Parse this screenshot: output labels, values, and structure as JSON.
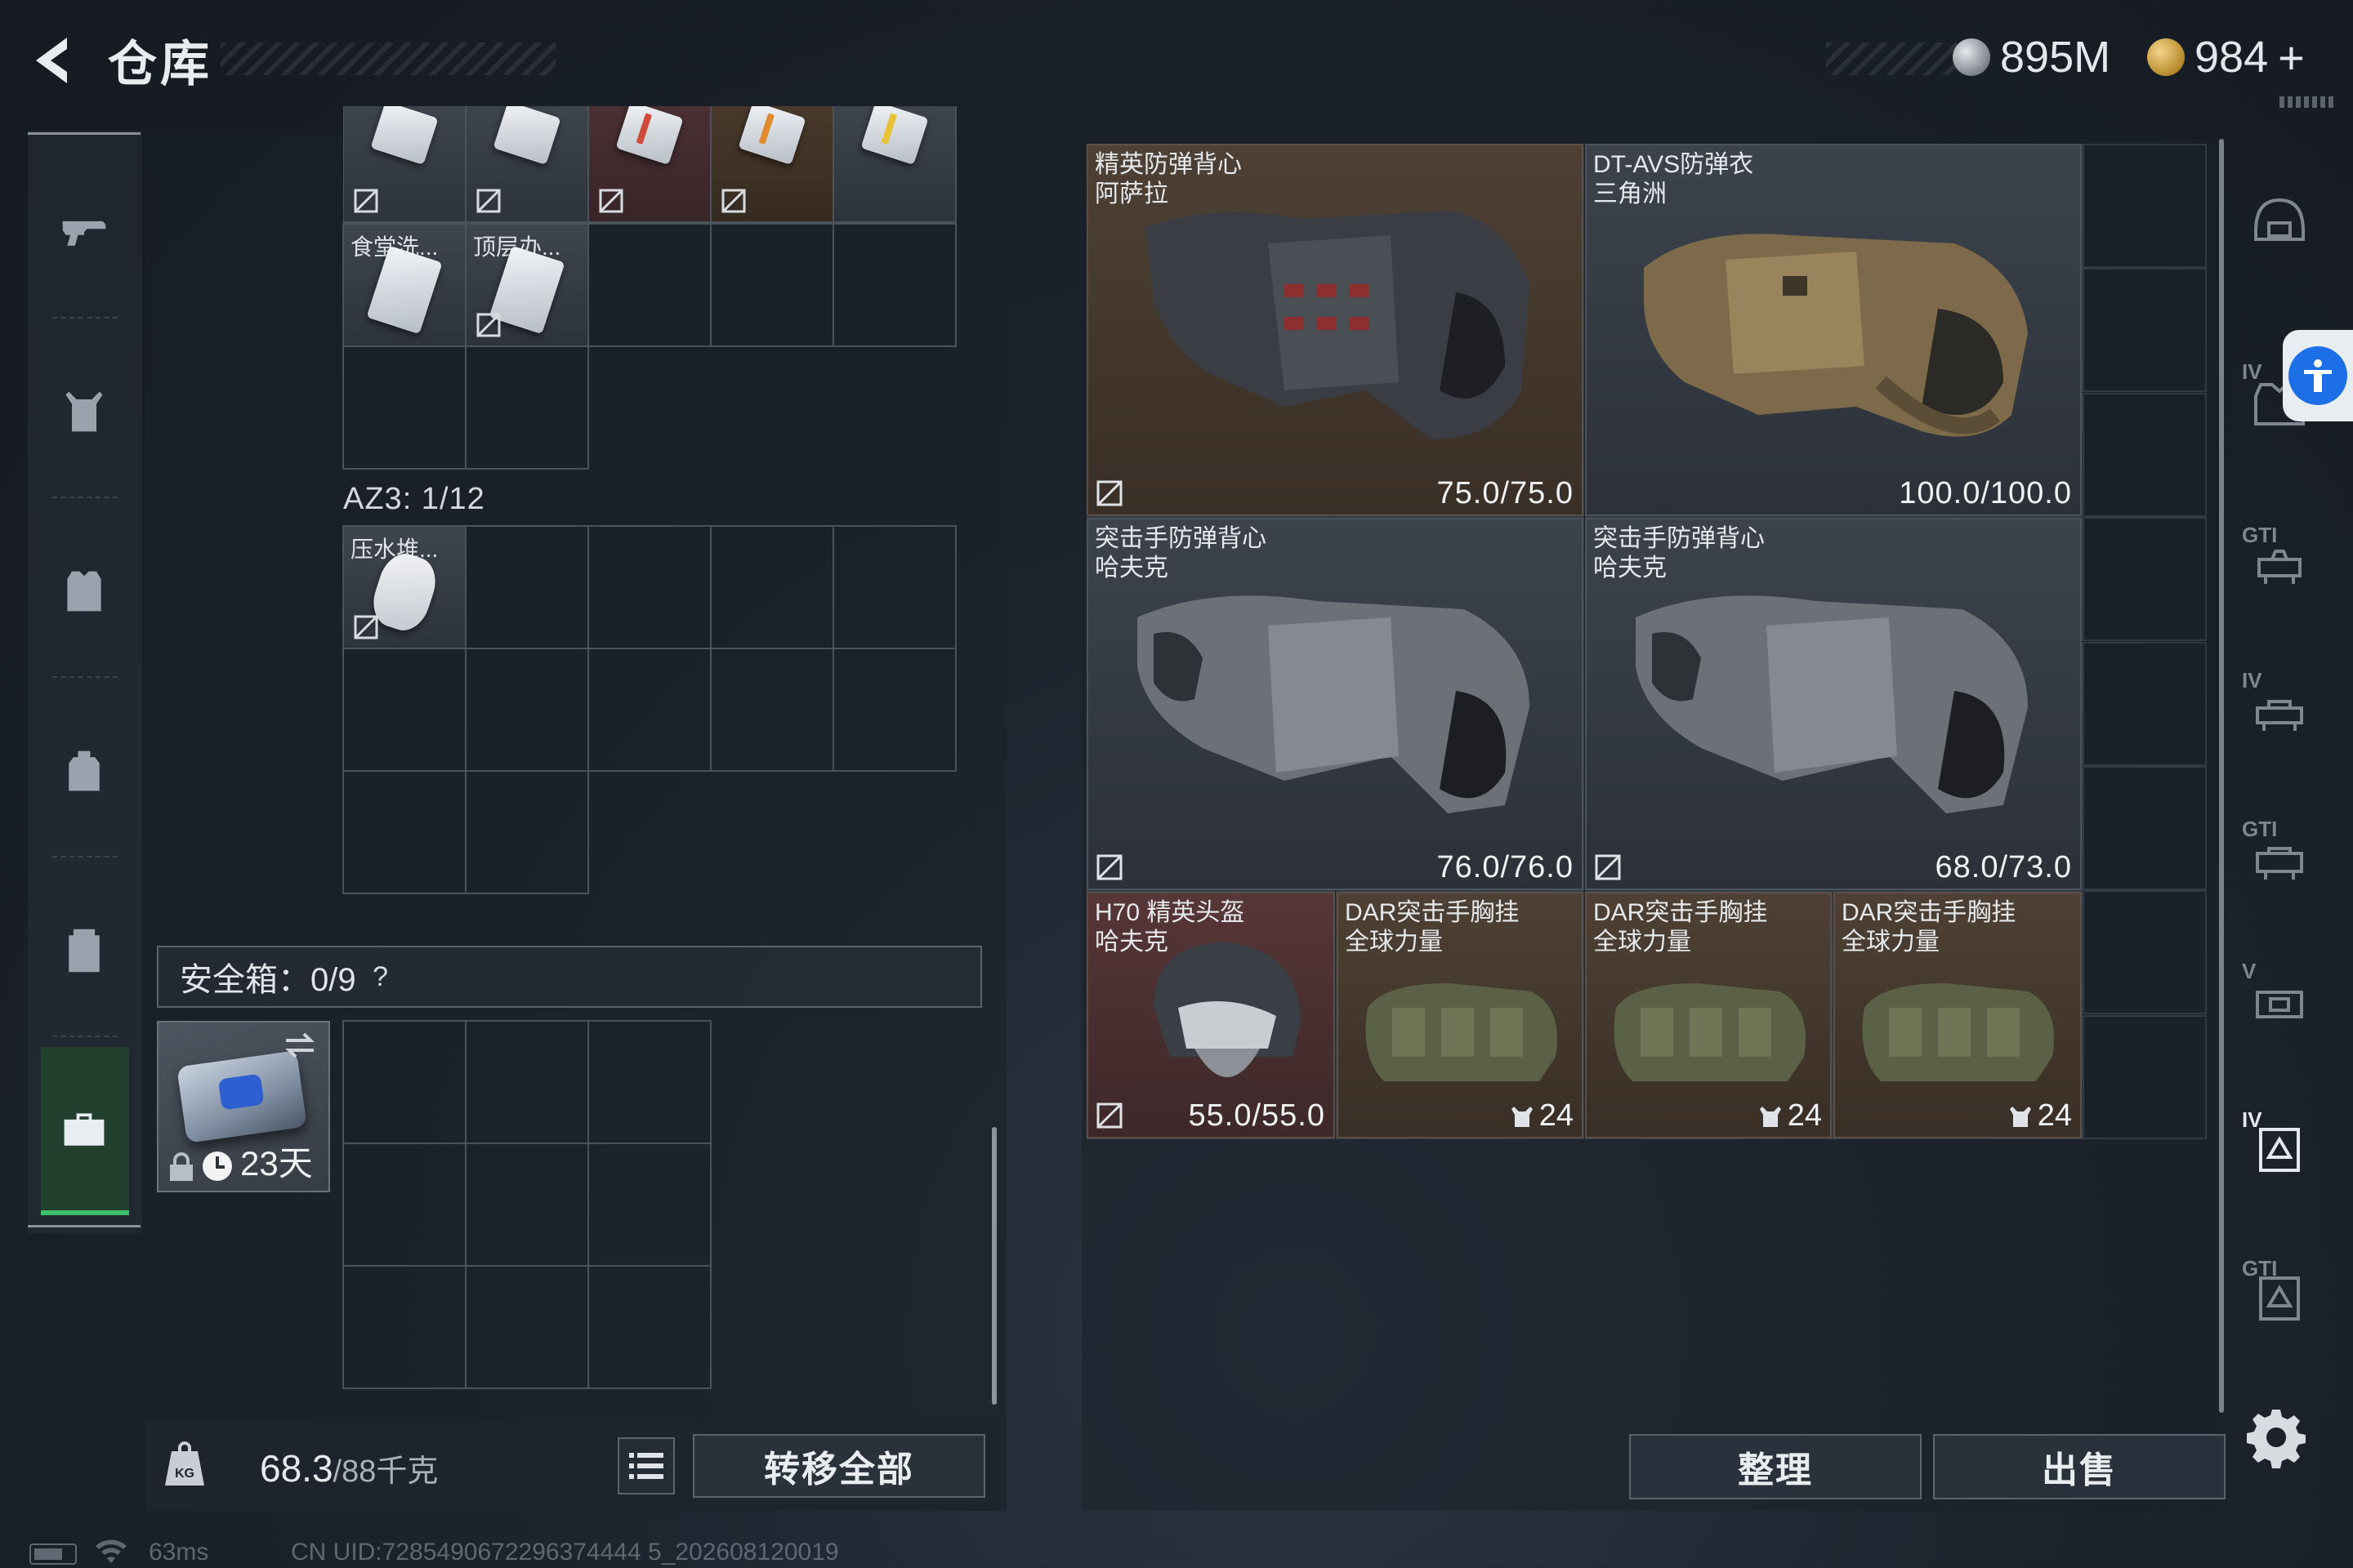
{
  "header": {
    "title": "仓库",
    "currency": [
      {
        "icon": "silver-coin-icon",
        "value": "895M"
      },
      {
        "icon": "gold-coin-icon",
        "value": "984"
      }
    ],
    "plus": "+"
  },
  "left_panel": {
    "top_items": [
      {
        "label": "",
        "stripe": "none"
      },
      {
        "label": "",
        "stripe": "none"
      },
      {
        "label": "",
        "stripe": "red"
      },
      {
        "label": "",
        "stripe": "orange"
      },
      {
        "label": "",
        "stripe": "yellow"
      }
    ],
    "row2_items": [
      {
        "label": "食堂洗..."
      },
      {
        "label": "顶层办..."
      }
    ],
    "container_label": "AZ3: 1/12",
    "container_items": [
      {
        "label": "压水堆..."
      }
    ],
    "safe_label": "安全箱：0/9",
    "safe_help": "?",
    "safe_item": {
      "days": "23天"
    },
    "weight": {
      "current": "68.3",
      "capacity": "/88千克"
    },
    "transfer_all": "转移全部"
  },
  "right_panel": {
    "items": [
      {
        "name": "精英防弹背心",
        "sub": "阿萨拉",
        "value": "75.0/75.0"
      },
      {
        "name": "DT-AVS防弹衣",
        "sub": "三角洲",
        "value": "100.0/100.0"
      },
      {
        "name": "突击手防弹背心",
        "sub": "哈夫克",
        "value": "76.0/76.0"
      },
      {
        "name": "突击手防弹背心",
        "sub": "哈夫克",
        "value": "68.0/73.0"
      },
      {
        "name": "H70 精英头盔",
        "sub": "哈夫克",
        "value": "55.0/55.0"
      },
      {
        "name": "DAR突击手胸挂",
        "sub": "全球力量",
        "value": "24"
      },
      {
        "name": "DAR突击手胸挂",
        "sub": "全球力量",
        "value": "24"
      },
      {
        "name": "DAR突击手胸挂",
        "sub": "全球力量",
        "value": "24"
      }
    ],
    "sort": "整理",
    "sell": "出售"
  },
  "right_icons": [
    {
      "name": "helmet-slot-icon",
      "level": ""
    },
    {
      "name": "armor-slot-icon",
      "level": "IV"
    },
    {
      "name": "armor-slot-icon",
      "level": "GTI"
    },
    {
      "name": "armor-slot-icon",
      "level": "IV"
    },
    {
      "name": "armor-slot-icon",
      "level": "GTI"
    },
    {
      "name": "armor-slot-icon",
      "level": "V"
    },
    {
      "name": "armor-slot-icon",
      "level": "IV"
    },
    {
      "name": "armor-slot-icon",
      "level": "GTI"
    }
  ],
  "status_bar": {
    "ping": "63ms",
    "uid": "CN UID:7285490672296374444 5_202608120019"
  },
  "colors": {
    "accent_green": "#3fbf6a",
    "accessibility_blue": "#1d6fe8",
    "slot_brown": "#4e4034",
    "slot_red": "#573636"
  }
}
